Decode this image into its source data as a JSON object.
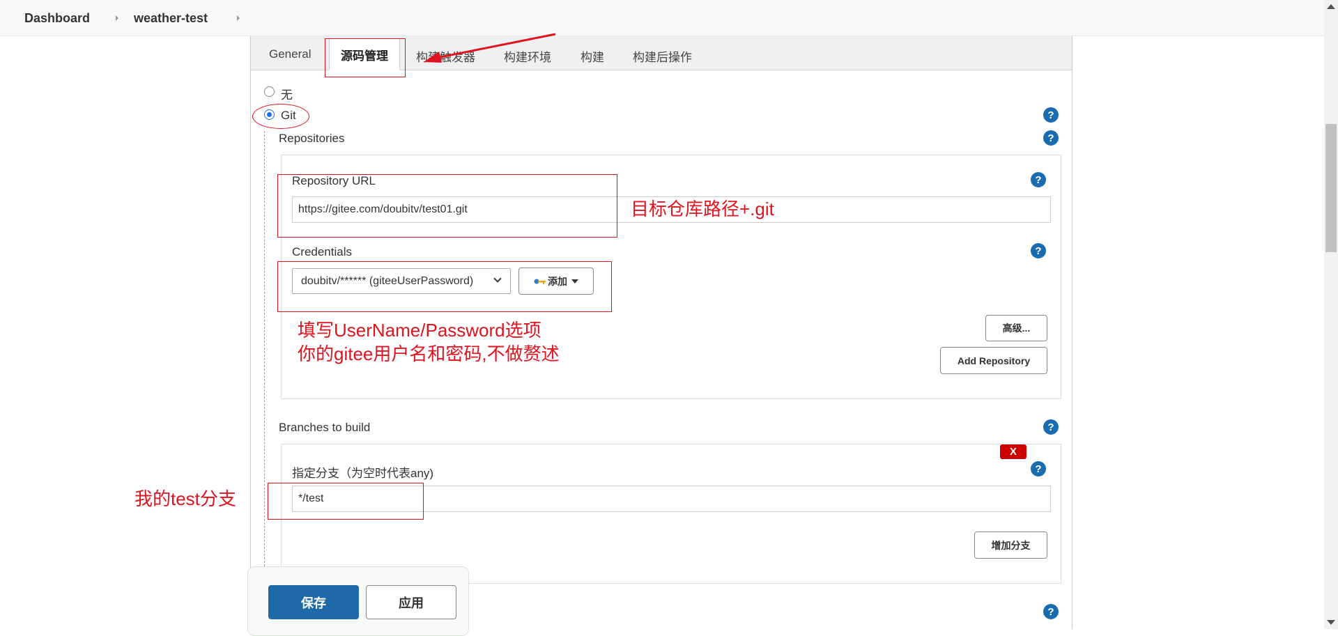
{
  "breadcrumb": {
    "items": [
      "Dashboard",
      "weather-test"
    ]
  },
  "tabs": [
    {
      "label": "General"
    },
    {
      "label": "源码管理"
    },
    {
      "label": "构建触发器"
    },
    {
      "label": "构建环境"
    },
    {
      "label": "构建"
    },
    {
      "label": "构建后操作"
    }
  ],
  "scm": {
    "option_none": "无",
    "option_git": "Git",
    "repositories_title": "Repositories",
    "repository_url_label": "Repository URL",
    "repository_url_value": "https://gitee.com/doubitv/test01.git",
    "credentials_label": "Credentials",
    "credentials_value": "doubitv/****** (giteeUserPassword)",
    "add_label": "添加",
    "advanced_label": "高级...",
    "add_repository_label": "Add Repository",
    "branches_title": "Branches to build",
    "branch_label": "指定分支（为空时代表any)",
    "branch_value": "*/test",
    "delete_label": "X",
    "add_branch_label": "增加分支"
  },
  "footer": {
    "save_label": "保存",
    "apply_label": "应用"
  },
  "annotations": {
    "repo_note": "目标仓库路径+.git",
    "cred_note_line1": "填写UserName/Password选项",
    "cred_note_line2": "你的gitee用户名和密码,不做赘述",
    "branch_note": "我的test分支"
  },
  "help_symbol": "?",
  "colors": {
    "annotation_red": "#e0141e",
    "help_blue": "#1a6cb0",
    "primary_blue": "#1e6aa8",
    "delete_red": "#cc0000"
  }
}
